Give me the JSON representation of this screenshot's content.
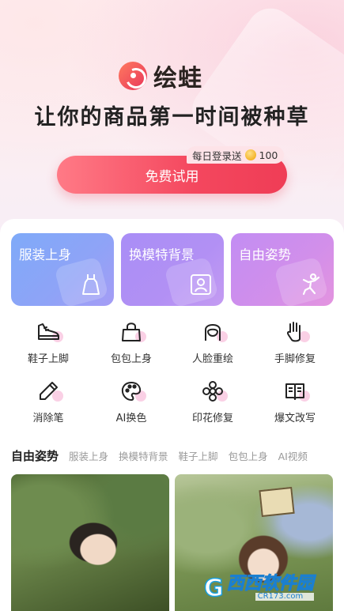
{
  "header": {
    "app_name": "绘蛙",
    "headline": "让你的商品第一时间被种草",
    "trial_button": "免费试用",
    "reward_badge": {
      "text": "每日登录送",
      "amount": "100"
    }
  },
  "feature_cards": [
    {
      "label": "服装上身",
      "icon": "dress-icon"
    },
    {
      "label": "换模特背景",
      "icon": "portrait-icon"
    },
    {
      "label": "自由姿势",
      "icon": "pose-figure-icon"
    }
  ],
  "tools": [
    {
      "label": "鞋子上脚",
      "icon": "sneaker-icon"
    },
    {
      "label": "包包上身",
      "icon": "handbag-icon"
    },
    {
      "label": "人脸重绘",
      "icon": "face-icon"
    },
    {
      "label": "手脚修复",
      "icon": "hand-icon"
    },
    {
      "label": "消除笔",
      "icon": "eraser-pen-icon"
    },
    {
      "label": "AI换色",
      "icon": "palette-icon"
    },
    {
      "label": "印花修复",
      "icon": "flower-pattern-icon"
    },
    {
      "label": "爆文改写",
      "icon": "book-icon"
    }
  ],
  "tabs": [
    {
      "label": "自由姿势",
      "active": true
    },
    {
      "label": "服装上身",
      "active": false
    },
    {
      "label": "换模特背景",
      "active": false
    },
    {
      "label": "鞋子上脚",
      "active": false
    },
    {
      "label": "包包上身",
      "active": false
    },
    {
      "label": "AI视频",
      "active": false
    }
  ],
  "gallery": [
    {
      "alt": "model-photo-1"
    },
    {
      "alt": "model-photo-2"
    }
  ],
  "watermark": {
    "brand": "西西软件园",
    "site": "CR173.com"
  },
  "colors": {
    "accent": "#f4475e",
    "card_blue": "#8fa3f7",
    "card_violet": "#b290f4",
    "card_pink": "#d28fea"
  }
}
